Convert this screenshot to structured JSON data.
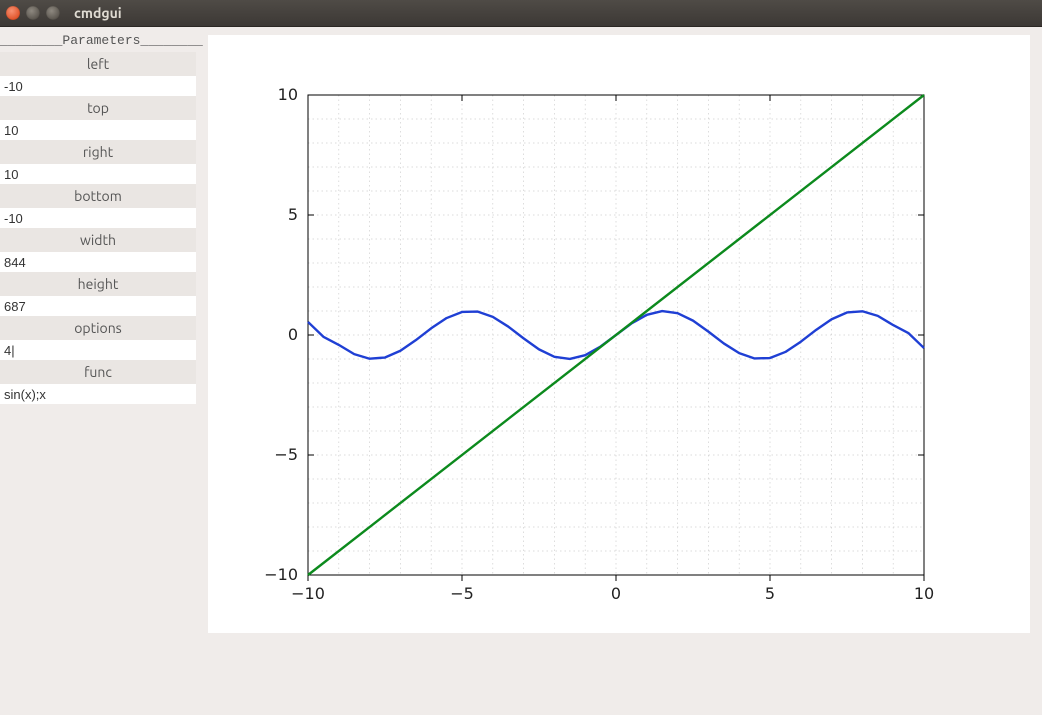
{
  "window": {
    "title": "cmdgui"
  },
  "sidebar": {
    "header": "________Parameters________",
    "params": [
      {
        "label": "left",
        "value": "-10"
      },
      {
        "label": "top",
        "value": "10"
      },
      {
        "label": "right",
        "value": "10"
      },
      {
        "label": "bottom",
        "value": "-10"
      },
      {
        "label": "width",
        "value": "844"
      },
      {
        "label": "height",
        "value": "687"
      },
      {
        "label": "options",
        "value": "4|"
      },
      {
        "label": "func",
        "value": "sin(x);x"
      }
    ]
  },
  "chart_data": {
    "type": "line",
    "xlim": [
      -10,
      10
    ],
    "ylim": [
      -10,
      10
    ],
    "xticks": [
      -10,
      -5,
      0,
      5,
      10
    ],
    "yticks": [
      -10,
      -5,
      0,
      5,
      10
    ],
    "series": [
      {
        "name": "sin(x)",
        "color": "#1f3fd4",
        "x": [
          -10,
          -9.5,
          -9,
          -8.5,
          -8,
          -7.5,
          -7,
          -6.5,
          -6,
          -5.5,
          -5,
          -4.5,
          -4,
          -3.5,
          -3,
          -2.5,
          -2,
          -1.5,
          -1,
          -0.5,
          0,
          0.5,
          1,
          1.5,
          2,
          2.5,
          3,
          3.5,
          4,
          4.5,
          5,
          5.5,
          6,
          6.5,
          7,
          7.5,
          8,
          8.5,
          9,
          9.5,
          10
        ],
        "y": [
          0.544,
          -0.075,
          -0.412,
          -0.798,
          -0.989,
          -0.938,
          -0.657,
          -0.215,
          0.279,
          0.706,
          0.959,
          0.978,
          0.757,
          0.351,
          -0.141,
          -0.599,
          -0.909,
          -0.997,
          -0.841,
          -0.479,
          0,
          0.479,
          0.841,
          0.997,
          0.909,
          0.599,
          0.141,
          -0.351,
          -0.757,
          -0.978,
          -0.959,
          -0.706,
          -0.279,
          0.215,
          0.657,
          0.938,
          0.989,
          0.798,
          0.412,
          0.075,
          -0.544
        ]
      },
      {
        "name": "x",
        "color": "#0c8a1d",
        "x": [
          -10,
          10
        ],
        "y": [
          -10,
          10
        ]
      }
    ],
    "title": "",
    "xlabel": "",
    "ylabel": ""
  }
}
